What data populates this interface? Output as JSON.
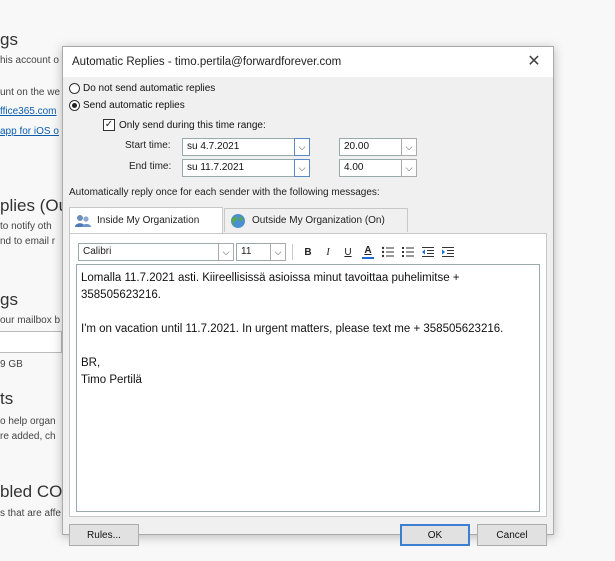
{
  "background": {
    "frag_settings": "gs",
    "frag_account": "his account o",
    "frag_on_web": "unt on the we",
    "frag_link1": "ffice365.com",
    "frag_link2": "app for iOS o",
    "frag_replies": "plies (Out",
    "frag_notify": "to notify oth",
    "frag_email": "nd to email r",
    "frag_settings2": "gs",
    "frag_mailbox": "our mailbox b",
    "frag_gb": "9 GB",
    "frag_ts": "ts",
    "frag_help": "o help organ",
    "frag_added": "re added, ch",
    "frag_bled": "bled CON",
    "frag_affe": "s that are affe"
  },
  "dialog": {
    "title": "Automatic Replies - timo.pertila@forwardforever.com",
    "close_glyph": "✕",
    "radio_off_label": "Do not send automatic replies",
    "radio_on_label": "Send automatic replies",
    "only_send_label": "Only send during this time range:",
    "check_glyph": "✓",
    "start_label": "Start time:",
    "start_date": "su 4.7.2021",
    "start_time": "20.00",
    "end_label": "End time:",
    "end_date": "su 11.7.2021",
    "end_time": "4.00",
    "reply_once_label": "Automatically reply once for each sender with the following messages:",
    "tab_inside": "Inside My Organization",
    "tab_outside": "Outside My Organization (On)",
    "font_name": "Calibri",
    "font_size": "11",
    "bold": "B",
    "italic": "I",
    "underline": "U",
    "font_color": "A",
    "message": {
      "line1": "Lomalla 11.7.2021 asti. Kiireellisissä asioissa minut tavoittaa puhelimitse + 358505623216.",
      "line2": "I'm on vacation until 11.7.2021. In urgent matters, please text me + 358505623216.",
      "line3": "BR,",
      "line4": "Timo Pertilä"
    },
    "rules_button": "Rules...",
    "ok_button": "OK",
    "cancel_button": "Cancel",
    "dropdown_glyph": "⌵",
    "colors": {
      "accent": "#3c7fd0",
      "font_color_bar": "#1e6bd6"
    }
  }
}
